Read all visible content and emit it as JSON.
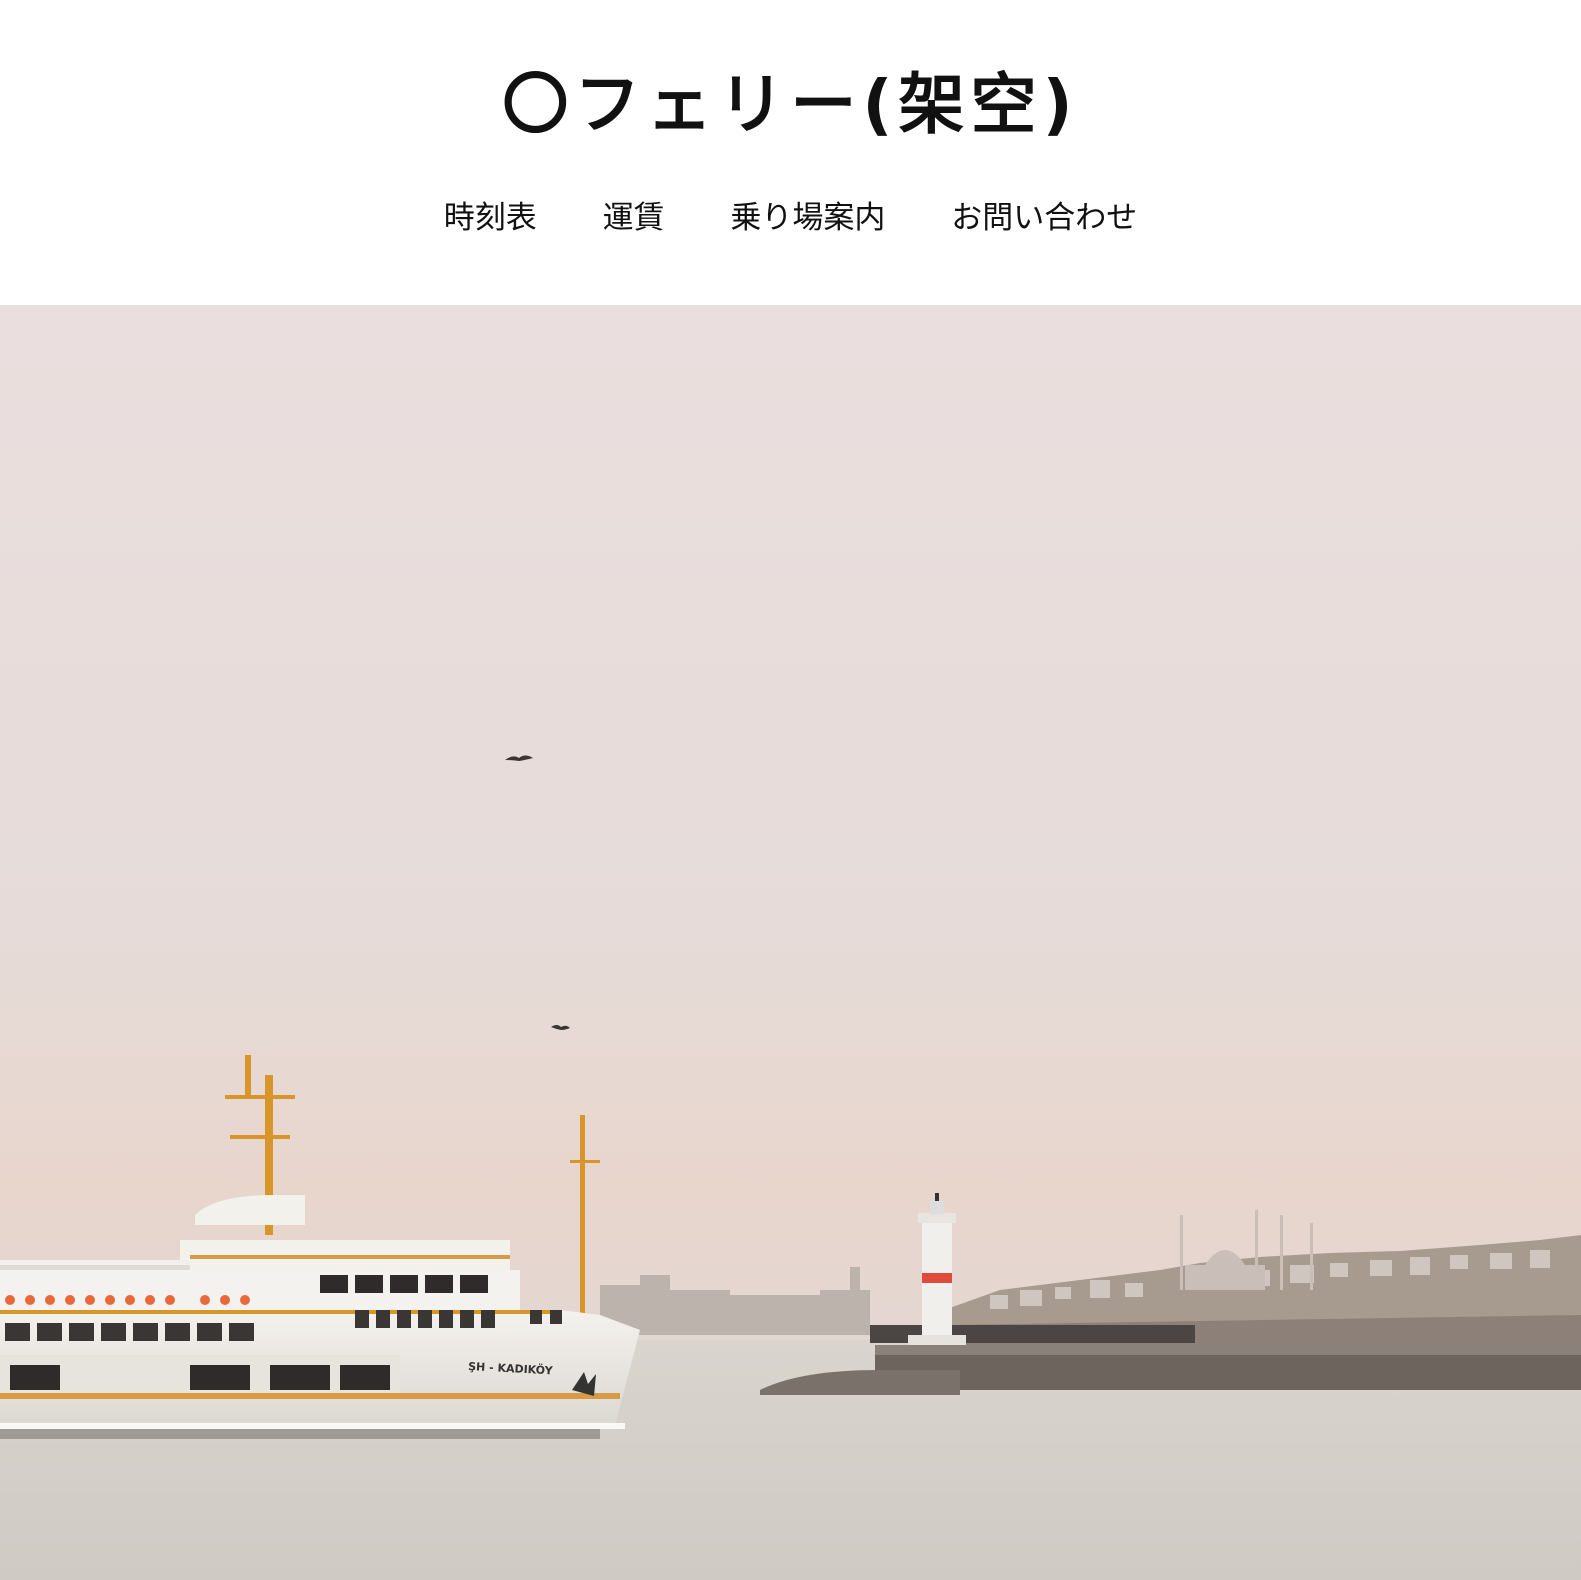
{
  "header": {
    "site_title": "〇フェリー(架空)"
  },
  "nav": {
    "items": [
      {
        "label": "時刻表"
      },
      {
        "label": "運賃"
      },
      {
        "label": "乗り場案内"
      },
      {
        "label": "お問い合わせ"
      }
    ]
  },
  "hero": {
    "ship_name": "ŞH - KADIKÖY",
    "colors": {
      "sky_top": "#e8dcdc",
      "sky_bottom": "#e3d6d2",
      "sea": "#d4d0c9",
      "lighthouse_stripe": "#e04a3a",
      "mast": "#d8952a"
    }
  }
}
